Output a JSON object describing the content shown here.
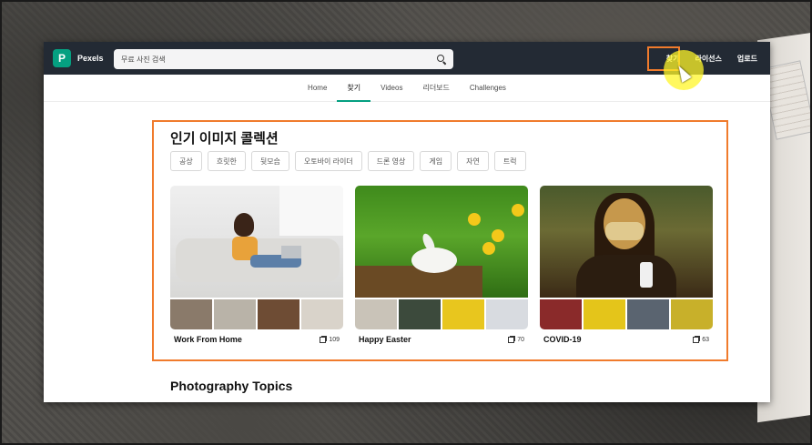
{
  "app": {
    "brand": "Pexels",
    "logo_letter": "P"
  },
  "search": {
    "placeholder": "무료 사진 검색"
  },
  "topnav": {
    "items": [
      "찾기",
      "라이선스",
      "업로드"
    ]
  },
  "subnav": {
    "tabs": [
      "Home",
      "찾기",
      "Videos",
      "리더보드",
      "Challenges"
    ],
    "active": "찾기"
  },
  "collections": {
    "title": "인기 이미지 콜렉션",
    "chips": [
      "공상",
      "흐릿한",
      "뒷모습",
      "오토바이 라이더",
      "드론 영상",
      "게임",
      "자연",
      "트럭"
    ],
    "cards": [
      {
        "name": "Work From Home",
        "count": "109"
      },
      {
        "name": "Happy Easter",
        "count": "70"
      },
      {
        "name": "COVID-19",
        "count": "63"
      }
    ]
  },
  "topics": {
    "title": "Photography Topics"
  },
  "colors": {
    "topbar": "#232a34",
    "accent": "#05a081",
    "highlight": "#f07b2c"
  }
}
